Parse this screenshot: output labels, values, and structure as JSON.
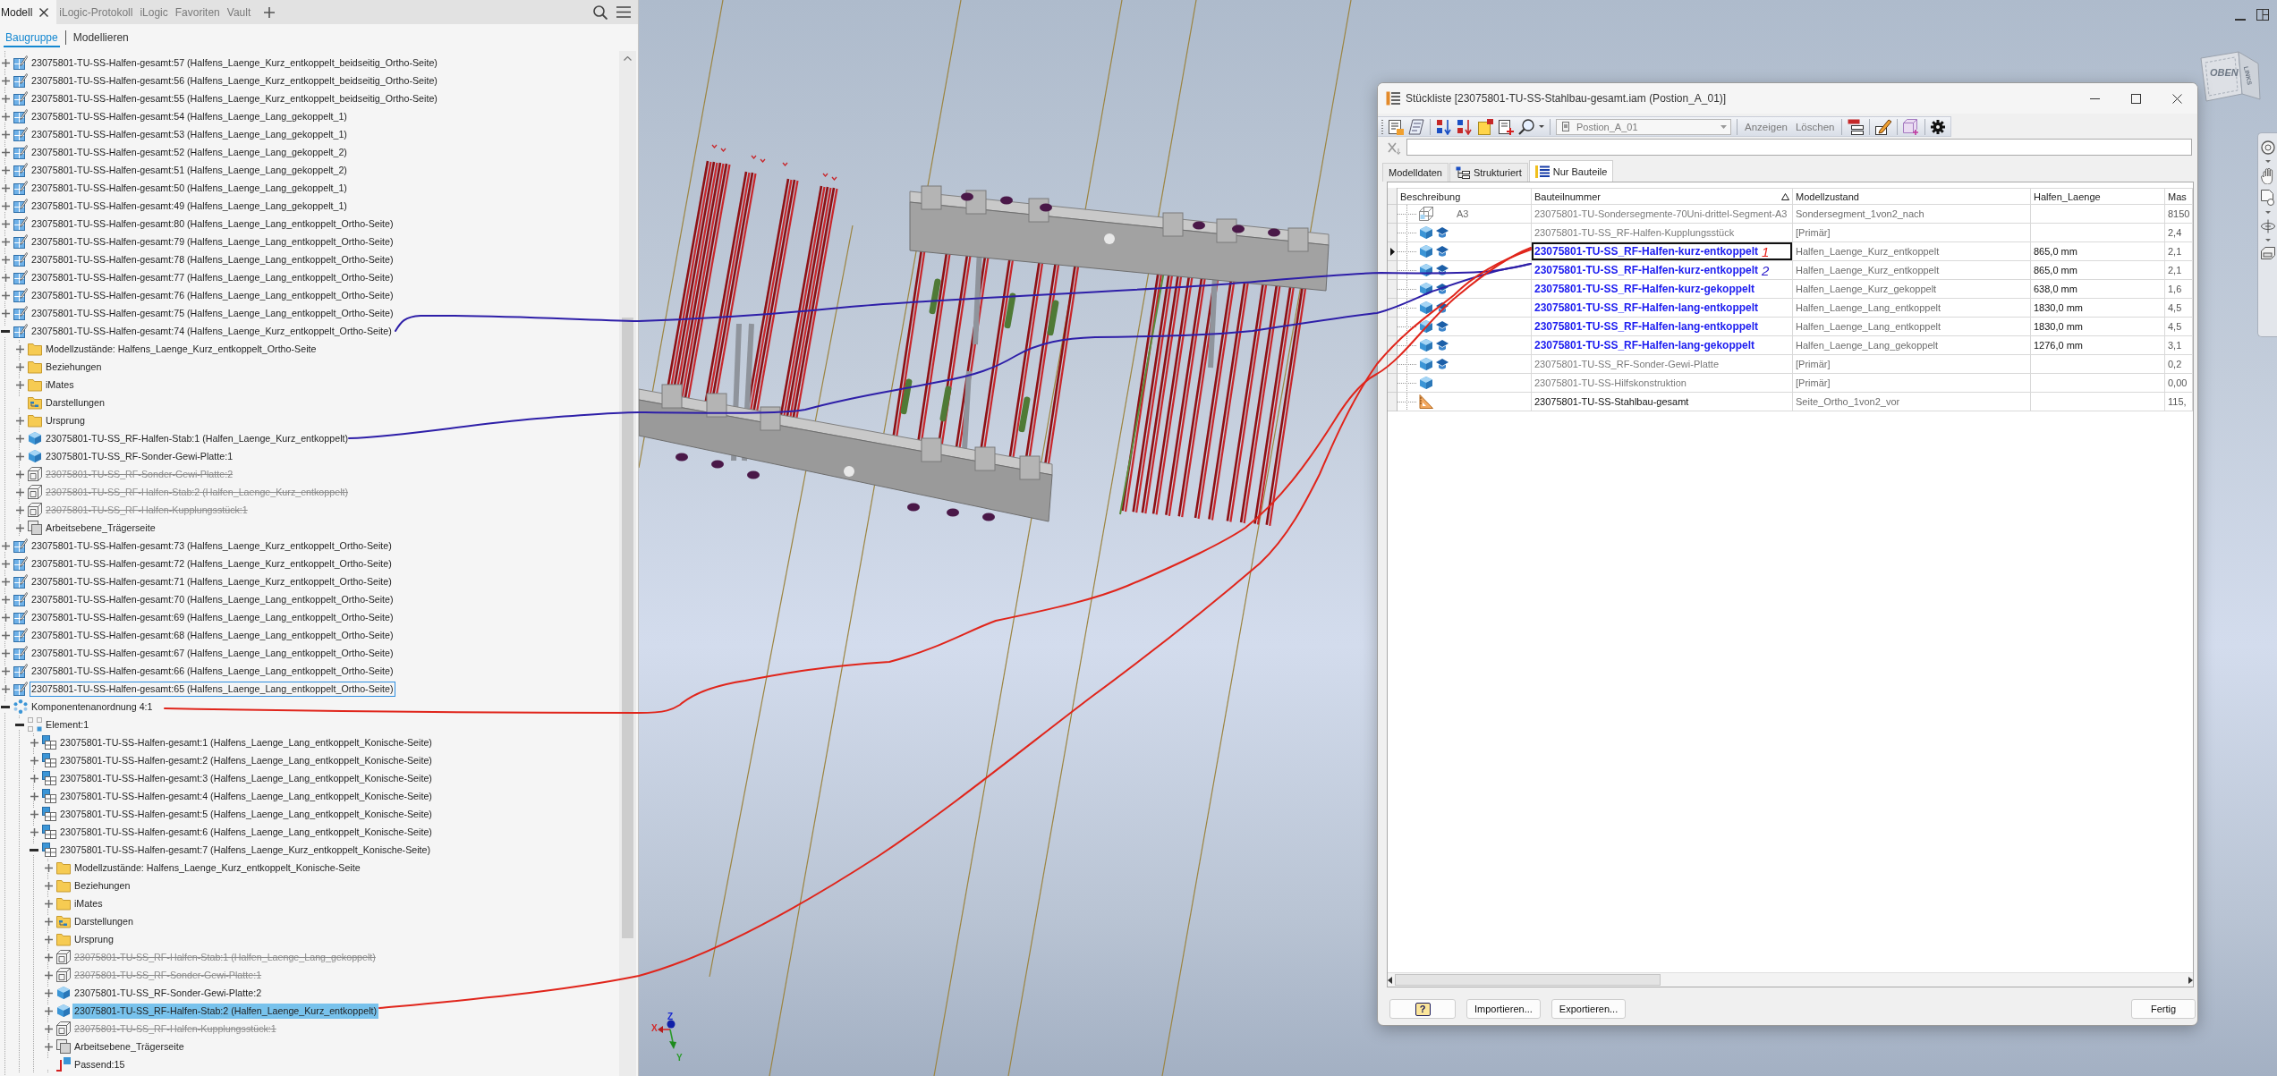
{
  "model_browser": {
    "tabs": [
      {
        "label": "Modell",
        "selected": true
      },
      {
        "label": "iLogic-Protokoll",
        "selected": false
      },
      {
        "label": "iLogic",
        "selected": false
      },
      {
        "label": "Favoriten",
        "selected": false
      },
      {
        "label": "Vault",
        "selected": false
      }
    ],
    "views": [
      {
        "label": "Baugruppe",
        "selected": true
      },
      {
        "label": "Modellieren",
        "selected": false
      }
    ],
    "tree": [
      {
        "label": "23075801-TU-SS-Halfen-gesamt:57 (Halfens_Laenge_Kurz_entkoppelt_beidseitig_Ortho-Seite)",
        "kind": "subassembly",
        "expanded": false,
        "selected": false,
        "focused": false,
        "suppressed": false
      },
      {
        "label": "23075801-TU-SS-Halfen-gesamt:56 (Halfens_Laenge_Kurz_entkoppelt_beidseitig_Ortho-Seite)",
        "kind": "subassembly",
        "expanded": false,
        "selected": false,
        "focused": false,
        "suppressed": false
      },
      {
        "label": "23075801-TU-SS-Halfen-gesamt:55 (Halfens_Laenge_Kurz_entkoppelt_beidseitig_Ortho-Seite)",
        "kind": "subassembly",
        "expanded": false,
        "selected": false,
        "focused": false,
        "suppressed": false
      },
      {
        "label": "23075801-TU-SS-Halfen-gesamt:54 (Halfens_Laenge_Lang_gekoppelt_1)",
        "kind": "subassembly",
        "expanded": false,
        "selected": false,
        "focused": false,
        "suppressed": false
      },
      {
        "label": "23075801-TU-SS-Halfen-gesamt:53 (Halfens_Laenge_Lang_gekoppelt_1)",
        "kind": "subassembly",
        "expanded": false,
        "selected": false,
        "focused": false,
        "suppressed": false
      },
      {
        "label": "23075801-TU-SS-Halfen-gesamt:52 (Halfens_Laenge_Lang_gekoppelt_2)",
        "kind": "subassembly",
        "expanded": false,
        "selected": false,
        "focused": false,
        "suppressed": false
      },
      {
        "label": "23075801-TU-SS-Halfen-gesamt:51 (Halfens_Laenge_Lang_gekoppelt_2)",
        "kind": "subassembly",
        "expanded": false,
        "selected": false,
        "focused": false,
        "suppressed": false
      },
      {
        "label": "23075801-TU-SS-Halfen-gesamt:50 (Halfens_Laenge_Lang_gekoppelt_1)",
        "kind": "subassembly",
        "expanded": false,
        "selected": false,
        "focused": false,
        "suppressed": false
      },
      {
        "label": "23075801-TU-SS-Halfen-gesamt:49 (Halfens_Laenge_Lang_gekoppelt_1)",
        "kind": "subassembly",
        "expanded": false,
        "selected": false,
        "focused": false,
        "suppressed": false
      },
      {
        "label": "23075801-TU-SS-Halfen-gesamt:80 (Halfens_Laenge_Lang_entkoppelt_Ortho-Seite)",
        "kind": "subassembly",
        "expanded": false,
        "selected": false,
        "focused": false,
        "suppressed": false
      },
      {
        "label": "23075801-TU-SS-Halfen-gesamt:79 (Halfens_Laenge_Lang_entkoppelt_Ortho-Seite)",
        "kind": "subassembly",
        "expanded": false,
        "selected": false,
        "focused": false,
        "suppressed": false
      },
      {
        "label": "23075801-TU-SS-Halfen-gesamt:78 (Halfens_Laenge_Lang_entkoppelt_Ortho-Seite)",
        "kind": "subassembly",
        "expanded": false,
        "selected": false,
        "focused": false,
        "suppressed": false
      },
      {
        "label": "23075801-TU-SS-Halfen-gesamt:77 (Halfens_Laenge_Lang_entkoppelt_Ortho-Seite)",
        "kind": "subassembly",
        "expanded": false,
        "selected": false,
        "focused": false,
        "suppressed": false
      },
      {
        "label": "23075801-TU-SS-Halfen-gesamt:76 (Halfens_Laenge_Lang_entkoppelt_Ortho-Seite)",
        "kind": "subassembly",
        "expanded": false,
        "selected": false,
        "focused": false,
        "suppressed": false
      },
      {
        "label": "23075801-TU-SS-Halfen-gesamt:75 (Halfens_Laenge_Lang_entkoppelt_Ortho-Seite)",
        "kind": "subassembly",
        "expanded": false,
        "selected": false,
        "focused": false,
        "suppressed": false
      },
      {
        "label": "23075801-TU-SS-Halfen-gesamt:74 (Halfens_Laenge_Kurz_entkoppelt_Ortho-Seite)",
        "kind": "subassembly",
        "expanded": true,
        "selected": false,
        "focused": false,
        "suppressed": false,
        "children": [
          {
            "label": "Modellzustände: Halfens_Laenge_Kurz_entkoppelt_Ortho-Seite",
            "kind": "folder",
            "expanded": false,
            "selected": false,
            "focused": false,
            "suppressed": false
          },
          {
            "label": "Beziehungen",
            "kind": "folder",
            "expanded": false,
            "selected": false,
            "focused": false,
            "suppressed": false
          },
          {
            "label": "iMates",
            "kind": "folder",
            "expanded": false,
            "selected": false,
            "focused": false,
            "suppressed": false
          },
          {
            "label": "Darstellungen",
            "kind": "representations",
            "selected": false,
            "focused": false,
            "suppressed": false
          },
          {
            "label": "Ursprung",
            "kind": "folder",
            "expanded": false,
            "selected": false,
            "focused": false,
            "suppressed": false
          },
          {
            "label": "23075801-TU-SS_RF-Halfen-Stab:1 (Halfen_Laenge_Kurz_entkoppelt)",
            "kind": "part",
            "expanded": false,
            "selected": false,
            "focused": false,
            "suppressed": false
          },
          {
            "label": "23075801-TU-SS_RF-Sonder-Gewi-Platte:1",
            "kind": "part",
            "expanded": false,
            "selected": false,
            "focused": false,
            "suppressed": false
          },
          {
            "label": "23075801-TU-SS_RF-Sonder-Gewi-Platte:2",
            "kind": "part",
            "expanded": false,
            "selected": false,
            "focused": false,
            "suppressed": true
          },
          {
            "label": "23075801-TU-SS_RF-Halfen-Stab:2 (Halfen_Laenge_Kurz_entkoppelt)",
            "kind": "part",
            "expanded": false,
            "selected": false,
            "focused": false,
            "suppressed": true
          },
          {
            "label": "23075801-TU-SS_RF-Halfen-Kupplungsstück:1",
            "kind": "part",
            "expanded": false,
            "selected": false,
            "focused": false,
            "suppressed": true
          },
          {
            "label": "Arbeitsebene_Trägerseite",
            "kind": "work-plane",
            "expanded": false,
            "selected": false,
            "focused": false,
            "suppressed": false
          }
        ]
      },
      {
        "label": "23075801-TU-SS-Halfen-gesamt:73 (Halfens_Laenge_Kurz_entkoppelt_Ortho-Seite)",
        "kind": "subassembly",
        "expanded": false,
        "selected": false,
        "focused": false,
        "suppressed": false
      },
      {
        "label": "23075801-TU-SS-Halfen-gesamt:72 (Halfens_Laenge_Kurz_entkoppelt_Ortho-Seite)",
        "kind": "subassembly",
        "expanded": false,
        "selected": false,
        "focused": false,
        "suppressed": false
      },
      {
        "label": "23075801-TU-SS-Halfen-gesamt:71 (Halfens_Laenge_Kurz_entkoppelt_Ortho-Seite)",
        "kind": "subassembly",
        "expanded": false,
        "selected": false,
        "focused": false,
        "suppressed": false
      },
      {
        "label": "23075801-TU-SS-Halfen-gesamt:70 (Halfens_Laenge_Lang_entkoppelt_Ortho-Seite)",
        "kind": "subassembly",
        "expanded": false,
        "selected": false,
        "focused": false,
        "suppressed": false
      },
      {
        "label": "23075801-TU-SS-Halfen-gesamt:69 (Halfens_Laenge_Lang_entkoppelt_Ortho-Seite)",
        "kind": "subassembly",
        "expanded": false,
        "selected": false,
        "focused": false,
        "suppressed": false
      },
      {
        "label": "23075801-TU-SS-Halfen-gesamt:68 (Halfens_Laenge_Lang_entkoppelt_Ortho-Seite)",
        "kind": "subassembly",
        "expanded": false,
        "selected": false,
        "focused": false,
        "suppressed": false
      },
      {
        "label": "23075801-TU-SS-Halfen-gesamt:67 (Halfens_Laenge_Lang_entkoppelt_Ortho-Seite)",
        "kind": "subassembly",
        "expanded": false,
        "selected": false,
        "focused": false,
        "suppressed": false
      },
      {
        "label": "23075801-TU-SS-Halfen-gesamt:66 (Halfens_Laenge_Lang_entkoppelt_Ortho-Seite)",
        "kind": "subassembly",
        "expanded": false,
        "selected": false,
        "focused": false,
        "suppressed": false
      },
      {
        "label": "23075801-TU-SS-Halfen-gesamt:65 (Halfens_Laenge_Lang_entkoppelt_Ortho-Seite)",
        "kind": "subassembly",
        "expanded": false,
        "selected": false,
        "focused": true,
        "suppressed": false
      },
      {
        "label": "Komponentenanordnung 4:1",
        "kind": "pattern",
        "expanded": true,
        "selected": false,
        "focused": false,
        "suppressed": false,
        "children": [
          {
            "label": "Element:1",
            "kind": "pattern-element",
            "expanded": true,
            "selected": false,
            "focused": false,
            "suppressed": false,
            "children": [
              {
                "label": "23075801-TU-SS-Halfen-gesamt:1 (Halfens_Laenge_Lang_entkoppelt_Konische-Seite)",
                "kind": "assembly",
                "expanded": false,
                "selected": false,
                "focused": false,
                "suppressed": false
              },
              {
                "label": "23075801-TU-SS-Halfen-gesamt:2 (Halfens_Laenge_Lang_entkoppelt_Konische-Seite)",
                "kind": "assembly",
                "expanded": false,
                "selected": false,
                "focused": false,
                "suppressed": false
              },
              {
                "label": "23075801-TU-SS-Halfen-gesamt:3 (Halfens_Laenge_Lang_entkoppelt_Konische-Seite)",
                "kind": "assembly",
                "expanded": false,
                "selected": false,
                "focused": false,
                "suppressed": false
              },
              {
                "label": "23075801-TU-SS-Halfen-gesamt:4 (Halfens_Laenge_Lang_entkoppelt_Konische-Seite)",
                "kind": "assembly",
                "expanded": false,
                "selected": false,
                "focused": false,
                "suppressed": false
              },
              {
                "label": "23075801-TU-SS-Halfen-gesamt:5 (Halfens_Laenge_Lang_entkoppelt_Konische-Seite)",
                "kind": "assembly",
                "expanded": false,
                "selected": false,
                "focused": false,
                "suppressed": false
              },
              {
                "label": "23075801-TU-SS-Halfen-gesamt:6 (Halfens_Laenge_Lang_entkoppelt_Konische-Seite)",
                "kind": "assembly",
                "expanded": false,
                "selected": false,
                "focused": false,
                "suppressed": false
              },
              {
                "label": "23075801-TU-SS-Halfen-gesamt:7 (Halfens_Laenge_Kurz_entkoppelt_Konische-Seite)",
                "kind": "assembly",
                "expanded": true,
                "selected": false,
                "focused": false,
                "suppressed": false,
                "children": [
                  {
                    "label": "Modellzustände: Halfens_Laenge_Kurz_entkoppelt_Konische-Seite",
                    "kind": "folder",
                    "expanded": false,
                    "selected": false,
                    "focused": false,
                    "suppressed": false
                  },
                  {
                    "label": "Beziehungen",
                    "kind": "folder",
                    "expanded": false,
                    "selected": false,
                    "focused": false,
                    "suppressed": false
                  },
                  {
                    "label": "iMates",
                    "kind": "folder",
                    "expanded": false,
                    "selected": false,
                    "focused": false,
                    "suppressed": false
                  },
                  {
                    "label": "Darstellungen",
                    "kind": "representations",
                    "expanded": false,
                    "selected": false,
                    "focused": false,
                    "suppressed": false
                  },
                  {
                    "label": "Ursprung",
                    "kind": "folder",
                    "expanded": false,
                    "selected": false,
                    "focused": false,
                    "suppressed": false
                  },
                  {
                    "label": "23075801-TU-SS_RF-Halfen-Stab:1 (Halfen_Laenge_Lang_gekoppelt)",
                    "kind": "part",
                    "expanded": false,
                    "selected": false,
                    "focused": false,
                    "suppressed": true
                  },
                  {
                    "label": "23075801-TU-SS_RF-Sonder-Gewi-Platte:1",
                    "kind": "part",
                    "expanded": false,
                    "selected": false,
                    "focused": false,
                    "suppressed": true
                  },
                  {
                    "label": "23075801-TU-SS_RF-Sonder-Gewi-Platte:2",
                    "kind": "part",
                    "expanded": false,
                    "selected": false,
                    "focused": false,
                    "suppressed": false
                  },
                  {
                    "label": "23075801-TU-SS_RF-Halfen-Stab:2 (Halfen_Laenge_Kurz_entkoppelt)",
                    "kind": "part",
                    "expanded": false,
                    "selected": true,
                    "focused": false,
                    "suppressed": false
                  },
                  {
                    "label": "23075801-TU-SS_RF-Halfen-Kupplungsstück:1",
                    "kind": "part",
                    "expanded": false,
                    "selected": false,
                    "focused": false,
                    "suppressed": true
                  },
                  {
                    "label": "Arbeitsebene_Trägerseite",
                    "kind": "work-plane",
                    "expanded": false,
                    "selected": false,
                    "focused": false,
                    "suppressed": false
                  },
                  {
                    "label": "Passend:15",
                    "kind": "constraint",
                    "selected": false,
                    "focused": false,
                    "suppressed": false
                  }
                ]
              }
            ]
          }
        ]
      }
    ]
  },
  "viewport": {
    "viewcube": {
      "top_face": "OBEN",
      "side_face": "LINKS"
    },
    "axis_labels": {
      "x": "X",
      "y": "Y",
      "z": "Z"
    }
  },
  "bom_dialog": {
    "title": "Stückliste [23075801-TU-SS-Stahlbau-gesamt.iam (Postion_A_01)]",
    "view_dropdown": {
      "value": "Postion_A_01",
      "disabled": true
    },
    "toolbar_buttons": [
      {
        "label": "Anzeigen",
        "disabled": true
      },
      {
        "label": "Löschen",
        "disabled": true
      }
    ],
    "tabs": [
      {
        "label": "Modelldaten",
        "selected": false
      },
      {
        "label": "Strukturiert",
        "selected": false
      },
      {
        "label": "Nur Bauteile",
        "selected": true
      }
    ],
    "table": {
      "columns": [
        {
          "label": "Beschreibung",
          "sorted": false
        },
        {
          "label": "Bauteilnummer",
          "sorted": true
        },
        {
          "label": "Modellzustand",
          "sorted": false
        },
        {
          "label": "Halfen_Laenge",
          "sorted": false
        },
        {
          "label": "Mas",
          "sorted": false
        }
      ],
      "rows": [
        {
          "kind": "assembly",
          "library": false,
          "selected": false,
          "greyed": true,
          "overridden": false,
          "description": "A3",
          "part_number": "23075801-TU-Sondersegmente-70Uni-drittel-Segment-A3",
          "model_state": "Sondersegment_1von2_nach",
          "column_5": "8150"
        },
        {
          "kind": "part",
          "library": true,
          "selected": false,
          "greyed": true,
          "overridden": false,
          "part_number": "23075801-TU-SS_RF-Halfen-Kupplungsstück",
          "model_state": "[Primär]",
          "column_5": "2,4"
        },
        {
          "kind": "part",
          "library": true,
          "selected": true,
          "greyed": false,
          "overridden": true,
          "part_number": "23075801-TU-SS_RF-Halfen-kurz-entkoppelt",
          "mark": {
            "text": "1",
            "color": "#e8201a"
          },
          "model_state": "Halfen_Laenge_Kurz_entkoppelt",
          "halfen_laenge": "865,0 mm",
          "column_5": "2,1"
        },
        {
          "kind": "part",
          "library": true,
          "selected": false,
          "greyed": false,
          "overridden": true,
          "part_number": "23075801-TU-SS_RF-Halfen-kurz-entkoppelt",
          "mark": {
            "text": "2",
            "color": "#2a1ccc"
          },
          "model_state": "Halfen_Laenge_Kurz_entkoppelt",
          "halfen_laenge": "865,0 mm",
          "column_5": "2,1"
        },
        {
          "kind": "part",
          "library": true,
          "selected": false,
          "greyed": false,
          "overridden": true,
          "part_number": "23075801-TU-SS_RF-Halfen-kurz-gekoppelt",
          "model_state": "Halfen_Laenge_Kurz_gekoppelt",
          "halfen_laenge": "638,0 mm",
          "column_5": "1,6"
        },
        {
          "kind": "part",
          "library": true,
          "selected": false,
          "greyed": false,
          "overridden": true,
          "part_number": "23075801-TU-SS_RF-Halfen-lang-entkoppelt",
          "model_state": "Halfen_Laenge_Lang_entkoppelt",
          "halfen_laenge": "1830,0 mm",
          "column_5": "4,5"
        },
        {
          "kind": "part",
          "library": true,
          "selected": false,
          "greyed": false,
          "overridden": true,
          "part_number": "23075801-TU-SS_RF-Halfen-lang-entkoppelt",
          "model_state": "Halfen_Laenge_Lang_entkoppelt",
          "halfen_laenge": "1830,0 mm",
          "column_5": "4,5"
        },
        {
          "kind": "part",
          "library": true,
          "selected": false,
          "greyed": false,
          "overridden": true,
          "part_number": "23075801-TU-SS_RF-Halfen-lang-gekoppelt",
          "model_state": "Halfen_Laenge_Lang_gekoppelt",
          "halfen_laenge": "1276,0 mm",
          "column_5": "3,1"
        },
        {
          "kind": "part",
          "library": true,
          "selected": false,
          "greyed": true,
          "overridden": false,
          "part_number": "23075801-TU-SS_RF-Sonder-Gewi-Platte",
          "model_state": "[Primär]",
          "column_5": "0,2"
        },
        {
          "kind": "part",
          "library": false,
          "selected": false,
          "greyed": true,
          "overridden": false,
          "part_number": "23075801-TU-SS-Hilfskonstruktion",
          "model_state": "[Primär]",
          "column_5": "0,00"
        },
        {
          "kind": "frame",
          "library": false,
          "selected": false,
          "greyed": false,
          "overridden": false,
          "part_number": "23075801-TU-SS-Stahlbau-gesamt",
          "model_state": "Seite_Ortho_1von2_vor",
          "column_5": "115,"
        }
      ]
    },
    "help_button": "?",
    "buttons": [
      "Importieren...",
      "Exportieren..."
    ],
    "done_button": "Fertig"
  }
}
